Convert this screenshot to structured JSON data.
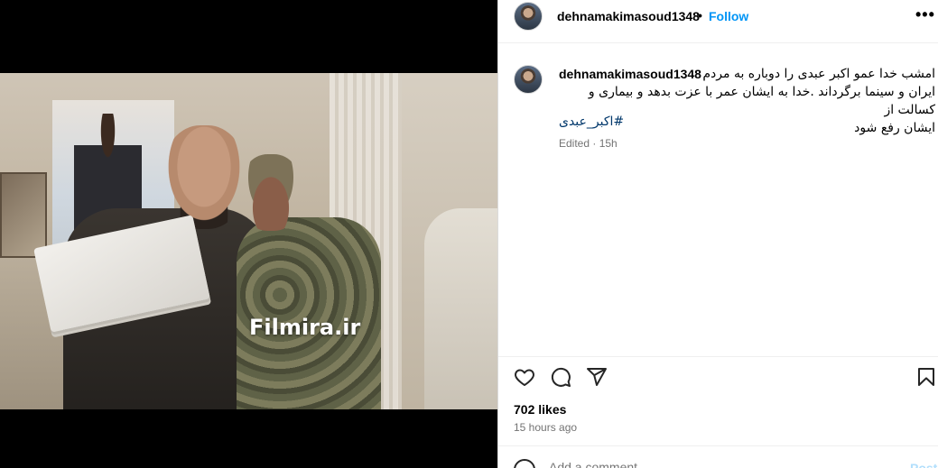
{
  "media": {
    "watermark": "Filmira.ir"
  },
  "header": {
    "username": "dehnamakimasoud1348",
    "separator": "•",
    "follow_label": "Follow",
    "more_label": "•••"
  },
  "caption": {
    "username": "dehnamakimasoud1348",
    "text_line1": "امشب خدا عمو اکبر عبدی را دوباره به مردم",
    "text_line2": "ایران و سینما برگرداند .خدا به ایشان عمر با عزت بدهد و بیماری و کسالت از",
    "text_line3": "ایشان رفع شود",
    "hashtag": "#اکبر_عبدی",
    "edited": "Edited · 15h"
  },
  "actions": {
    "icons": [
      "heart-icon",
      "comment-icon",
      "share-icon",
      "bookmark-icon"
    ]
  },
  "stats": {
    "likes": "702 likes",
    "time_ago": "15 hours ago"
  },
  "comment": {
    "placeholder": "Add a comment...",
    "post_label": "Post"
  },
  "colors": {
    "accent": "#0095f6",
    "hashtag": "#00376b",
    "muted": "#737373"
  }
}
